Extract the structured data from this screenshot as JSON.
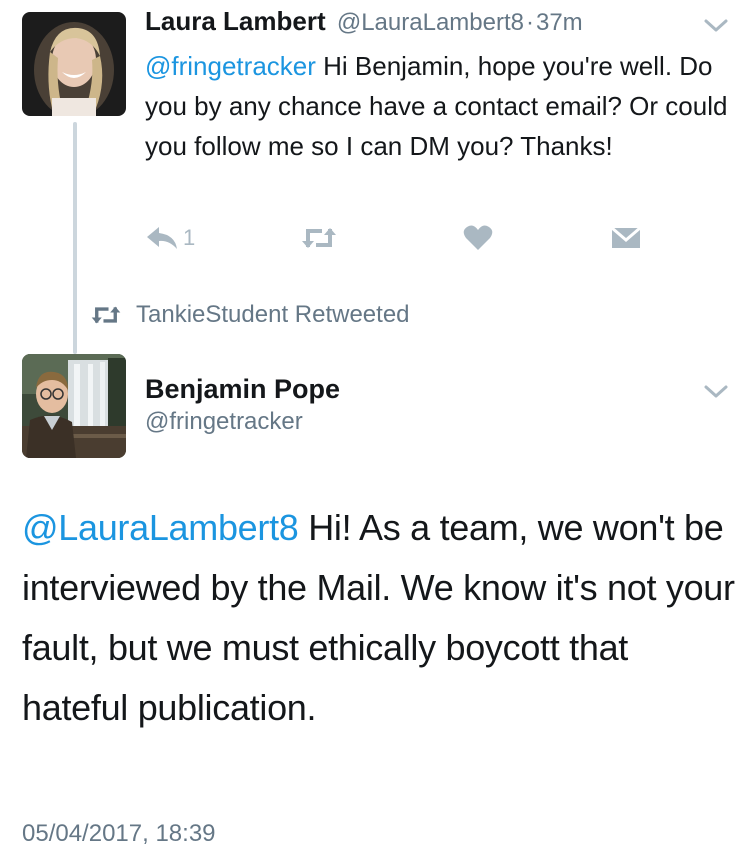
{
  "tweet1": {
    "author_name": "Laura Lambert",
    "author_handle": "@LauraLambert8",
    "separator": "·",
    "time_ago": "37m",
    "mention": "@fringetracker",
    "text": " Hi Benjamin, hope you're well. Do you by any chance have a contact email? Or could you follow me so I can DM you? Thanks!",
    "reply_count": "1",
    "icons": {
      "menu": "chevron-down-icon",
      "reply": "reply-icon",
      "retweet": "retweet-icon",
      "like": "heart-icon",
      "dm": "envelope-icon"
    }
  },
  "retweet_context": {
    "label": "TankieStudent Retweeted",
    "icon": "retweet-icon"
  },
  "tweet2": {
    "author_name": "Benjamin Pope",
    "author_handle": "@fringetracker",
    "mention": "@LauraLambert8",
    "text": " Hi! As a team, we won't be interviewed by the Mail. We know it's not your fault, but we must ethically boycott that hateful publication.",
    "timestamp": "05/04/2017, 18:39",
    "icons": {
      "menu": "chevron-down-icon"
    }
  },
  "colors": {
    "link": "#1b95e0",
    "text": "#14171a",
    "secondary": "#657786",
    "icon": "#aab8c2",
    "thread_line": "#ccd6dd"
  }
}
